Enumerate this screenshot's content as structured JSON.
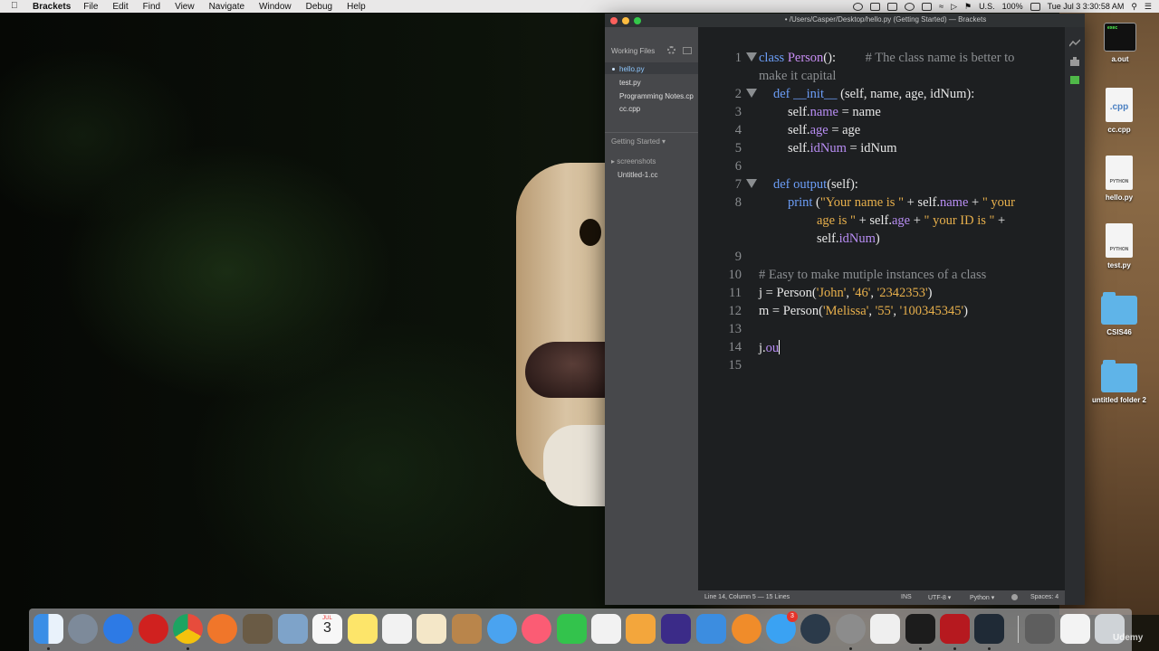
{
  "menubar": {
    "app": "Brackets",
    "items": [
      "File",
      "Edit",
      "Find",
      "View",
      "Navigate",
      "Window",
      "Debug",
      "Help"
    ],
    "input_source": "U.S.",
    "battery": "100%",
    "datetime": "Tue Jul 3  3:30:58 AM"
  },
  "window": {
    "title": "• /Users/Casper/Desktop/hello.py (Getting Started) — Brackets"
  },
  "sidebar": {
    "working_files_label": "Working Files",
    "working_files": [
      "hello.py",
      "test.py",
      "Programming Notes.cp",
      "cc.cpp"
    ],
    "project_label": "Getting Started ▾",
    "tree": [
      {
        "label": "▸ screenshots"
      },
      {
        "label": "Untitled-1.cc"
      }
    ]
  },
  "editor": {
    "gutter": [
      "1",
      "2",
      "3",
      "4",
      "5",
      "6",
      "7",
      "8",
      "9",
      "10",
      "11",
      "12",
      "13",
      "14",
      "15"
    ]
  },
  "status": {
    "position": "Line 14, Column 5 — 15 Lines",
    "mode": "INS",
    "encoding": "UTF-8 ▾",
    "language": "Python ▾",
    "spaces": "Spaces: 4"
  },
  "desktop_icons": [
    {
      "label": "a.out",
      "kind": "exec",
      "tag": "exec"
    },
    {
      "label": "cc.cpp",
      "kind": "doc",
      "tag": ".cpp"
    },
    {
      "label": "hello.py",
      "kind": "doc",
      "tag": "PYTHON"
    },
    {
      "label": "test.py",
      "kind": "doc",
      "tag": "PYTHON"
    },
    {
      "label": "CSIS46",
      "kind": "folder"
    },
    {
      "label": "untitled folder 2",
      "kind": "folder"
    }
  ],
  "dock": {
    "calendar_month": "JUL",
    "calendar_day": "3",
    "appstore_badge": "3"
  },
  "watermark": "Udemy"
}
